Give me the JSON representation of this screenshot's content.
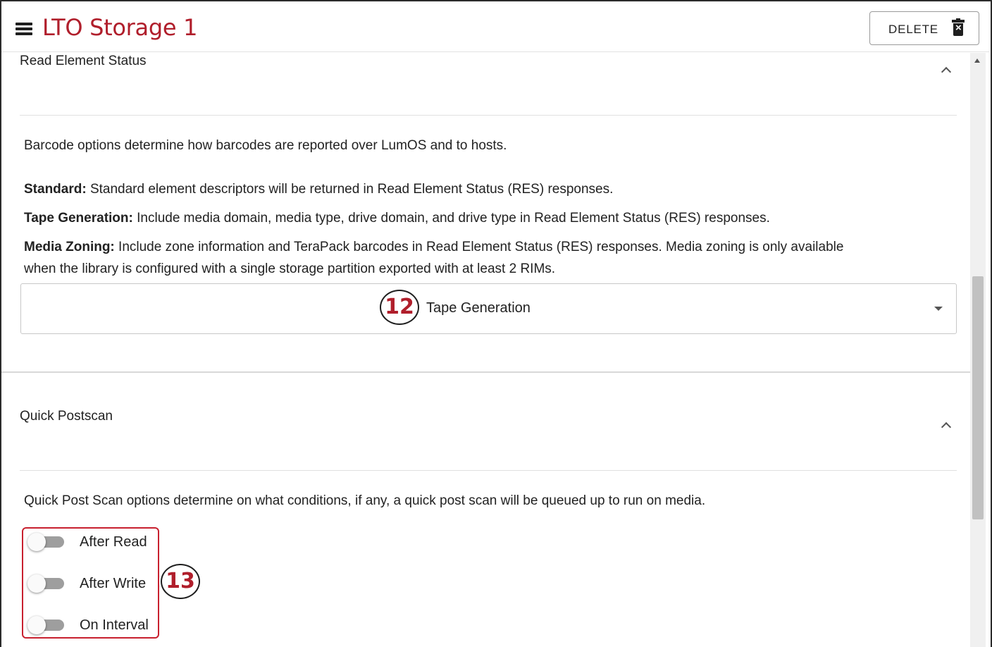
{
  "header": {
    "title": "LTO Storage 1",
    "delete_label": "DELETE",
    "menu_icon": "menu-icon",
    "delete_icon": "trash-icon",
    "title_color": "#b01e2b"
  },
  "read_element_status": {
    "title": "Read Element Status",
    "intro": "Barcode options determine how barcodes are reported over LumOS and to hosts.",
    "options": [
      {
        "name": "Standard:",
        "description": " Standard element descriptors will be returned in Read Element Status (RES) responses."
      },
      {
        "name": "Tape Generation:",
        "description": " Include media domain, media type, drive domain, and drive type in Read Element Status (RES) responses."
      },
      {
        "name": "Media Zoning:",
        "description": " Include zone information and TeraPack barcodes in Read Element Status (RES) responses. Media zoning is only available",
        "description_line2": "when the library is configured with a single storage partition exported with at least 2 RIMs."
      }
    ],
    "selected_value": "Tape Generation"
  },
  "quick_postscan": {
    "title": "Quick Postscan",
    "intro": "Quick Post Scan options determine on what conditions, if any, a quick post scan will be queued up to run on media.",
    "toggles": [
      {
        "label": "After Read",
        "on": false
      },
      {
        "label": "After Write",
        "on": false
      },
      {
        "label": "On Interval",
        "on": false
      }
    ]
  },
  "callouts": {
    "select": "12",
    "toggles": "13"
  },
  "colors": {
    "accent": "#b01e2b",
    "callout_border": "#c8202f"
  }
}
